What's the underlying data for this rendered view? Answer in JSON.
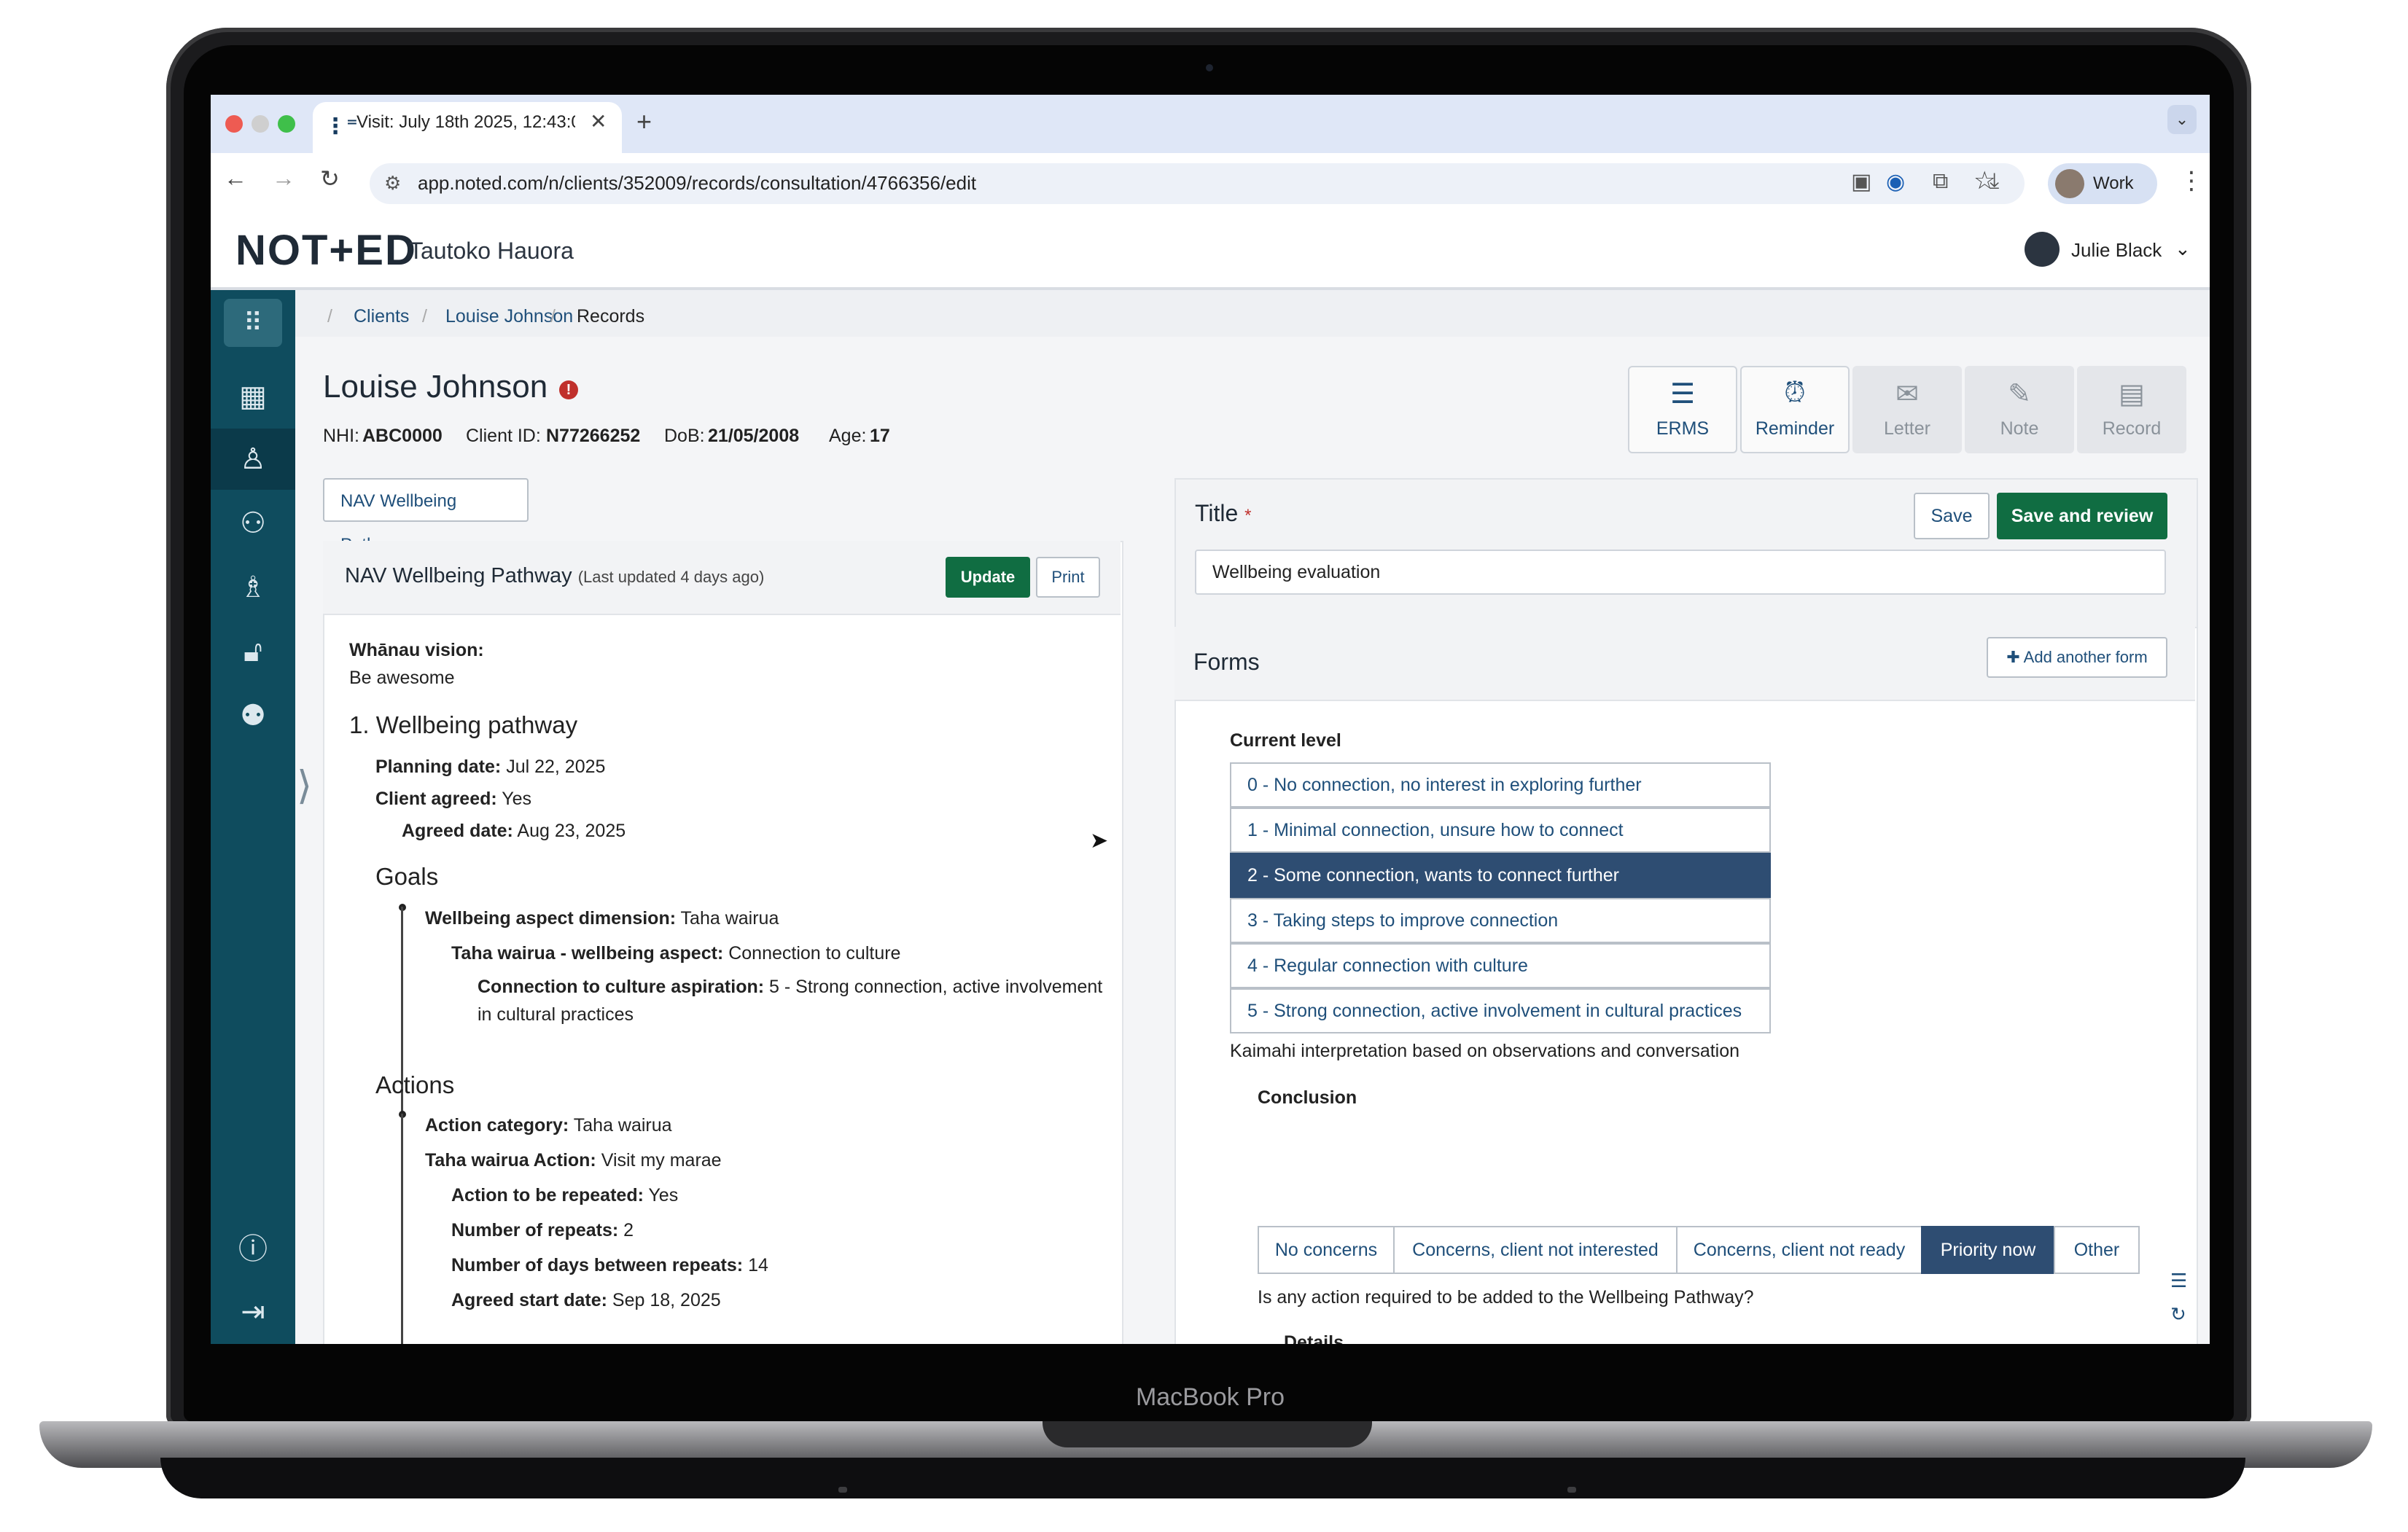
{
  "browser": {
    "tab_title": "Visit: July 18th 2025, 12:43:0",
    "tab_icon": "noted-logo-icon",
    "url": "app.noted.com/n/clients/352009/records/consultation/4766356/edit",
    "profile_label": "Work"
  },
  "app": {
    "logo": "NOT+ED",
    "org_name": "Tautoko Hauora",
    "user_name": "Julie Black"
  },
  "breadcrumb": [
    "Clients",
    "Louise Johnson",
    "Records"
  ],
  "client": {
    "name": "Louise Johnson",
    "nhi_label": "NHI:",
    "nhi": "ABC0000",
    "client_id_label": "Client ID:",
    "client_id": "N77266252",
    "dob_label": "DoB:",
    "dob": "21/05/2008",
    "age_label": "Age:",
    "age": "17"
  },
  "toolbar": {
    "erms": "ERMS",
    "reminder": "Reminder",
    "letter": "Letter",
    "note": "Note",
    "record": "Record"
  },
  "pathway": {
    "dropdown": "NAV Wellbeing Pathway",
    "card_title": "NAV Wellbeing Pathway",
    "card_updated": "(Last updated 4 days ago)",
    "update_btn": "Update",
    "print_btn": "Print",
    "vision_label": "Whānau vision:",
    "vision_value": "Be awesome",
    "section_title": "1. Wellbeing pathway",
    "planning_label": "Planning date:",
    "planning_value": "Jul 22, 2025",
    "agreed_label": "Client agreed:",
    "agreed_value": "Yes",
    "agreed_date_label": "Agreed date:",
    "agreed_date_value": "Aug 23, 2025",
    "goals_title": "Goals",
    "goal_dim_label": "Wellbeing aspect dimension:",
    "goal_dim_value": "Taha wairua",
    "goal_aspect_label": "Taha wairua - wellbeing aspect:",
    "goal_aspect_value": "Connection to culture",
    "goal_asp_label": "Connection to culture aspiration:",
    "goal_asp_value_1": "5 - Strong connection, active involvement",
    "goal_asp_value_2": "in cultural practices",
    "actions_title": "Actions",
    "action_cat_label": "Action category:",
    "action_cat_value": "Taha wairua",
    "action_label": "Taha wairua Action:",
    "action_value": "Visit my marae",
    "repeat_label": "Action to be repeated:",
    "repeat_value": "Yes",
    "num_repeats_label": "Number of repeats:",
    "num_repeats_value": "2",
    "days_between_label": "Number of days between repeats:",
    "days_between_value": "14",
    "start_date_label": "Agreed start date:",
    "start_date_value": "Sep 18, 2025"
  },
  "record": {
    "title_label": "Title",
    "required_mark": "*",
    "save_btn": "Save",
    "save_review_btn": "Save and review",
    "title_value": "Wellbeing evaluation",
    "forms_label": "Forms",
    "add_form_btn": "Add another form",
    "current_level_label": "Current level",
    "levels": [
      "0 - No connection, no interest in exploring further",
      "1 - Minimal connection, unsure how to connect",
      "2 - Some connection, wants to connect further",
      "3 - Taking steps to improve connection",
      "4 - Regular connection with culture",
      "5 - Strong connection, active involvement in cultural practices"
    ],
    "selected_level_index": 2,
    "level_hint": "Kaimahi interpretation based on observations and conversation",
    "conclusion_label": "Conclusion",
    "conclusions": [
      "No concerns",
      "Concerns, client not interested",
      "Concerns, client not ready",
      "Priority now",
      "Other"
    ],
    "selected_conclusion_index": 3,
    "action_question": "Is any action required to be added to the Wellbeing Pathway?",
    "details_label": "Details"
  },
  "device": {
    "model": "MacBook Pro"
  },
  "colors": {
    "brand_green": "#106d42",
    "sidebar_teal": "#0f4c5e",
    "selected_blue": "#2e4d72",
    "alert_red": "#c0302c"
  }
}
